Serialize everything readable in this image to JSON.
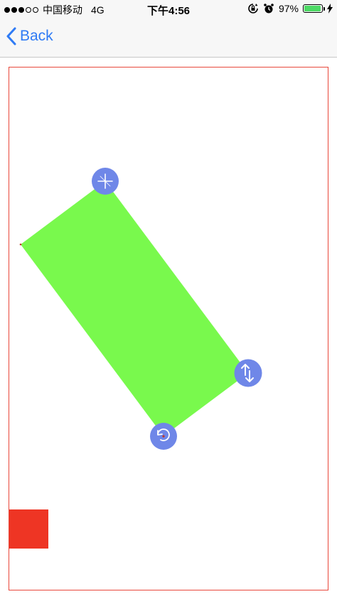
{
  "status_bar": {
    "signal_dots": [
      true,
      true,
      true,
      false,
      false
    ],
    "carrier": "中国移动",
    "network": "4G",
    "time": "下午4:56",
    "battery_percent_label": "97%",
    "battery_level": 0.97,
    "icons": [
      "orientation-lock-icon",
      "alarm-icon",
      "battery-icon",
      "charging-icon"
    ]
  },
  "nav": {
    "back_label": "Back",
    "back_icon": "chevron-left-icon",
    "accent_color": "#2f7bf5"
  },
  "editor": {
    "frame_color": "#e8473b",
    "shape_color": "#79f94d",
    "handle_color": "#6f87e8",
    "handles": {
      "move": "move-icon",
      "resize": "resize-vertical-icon",
      "rotate": "rotate-icon"
    },
    "swatch_color": "#ee3524"
  }
}
